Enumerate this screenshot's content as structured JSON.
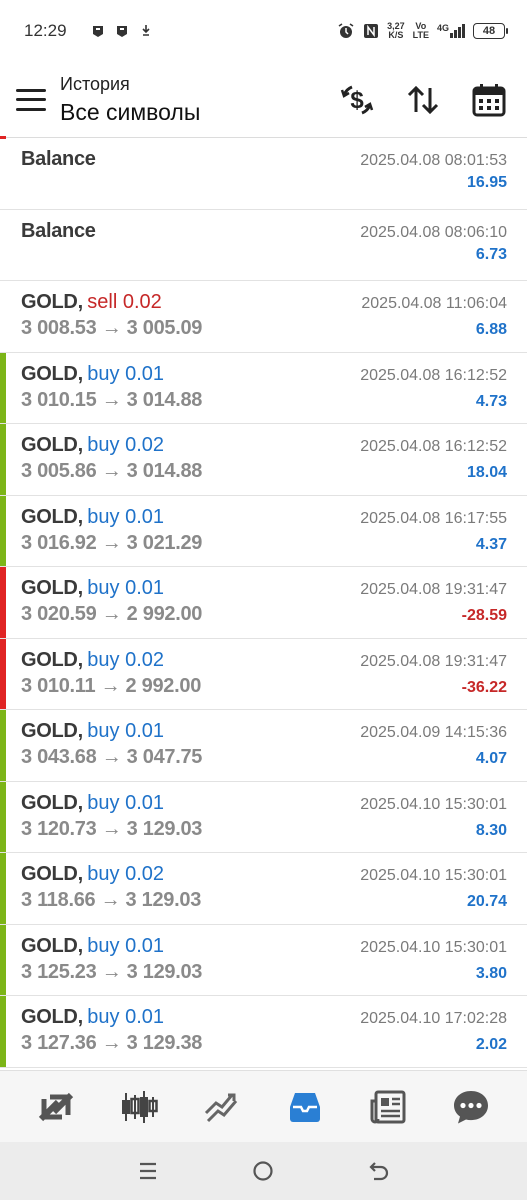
{
  "status_bar": {
    "time": "12:29",
    "speed_value": "3,27",
    "speed_unit": "K/S",
    "volte_top": "Vo",
    "volte_bottom": "LTE",
    "network": "4G",
    "battery": "48"
  },
  "header": {
    "subtitle": "История",
    "title": "Все символы"
  },
  "colors": {
    "buy": "#1f72c9",
    "sell": "#c62828",
    "bar_win": "#7cb518",
    "bar_loss": "#e02424"
  },
  "deals": [
    {
      "symbol": "Balance",
      "separator": "",
      "deal": "",
      "type": "none",
      "date": "2025.04.08 08:01:53",
      "prices": "",
      "profit": "16.95",
      "sign": "pos",
      "bar": "none"
    },
    {
      "symbol": "Balance",
      "separator": "",
      "deal": "",
      "type": "none",
      "date": "2025.04.08 08:06:10",
      "prices": "",
      "profit": "6.73",
      "sign": "pos",
      "bar": "none"
    },
    {
      "symbol": "GOLD",
      "separator": ",",
      "deal": "sell 0.02",
      "type": "sell",
      "date": "2025.04.08 11:06:04",
      "prices": "3 008.53 → 3 005.09",
      "profit": "6.88",
      "sign": "pos",
      "bar": "none"
    },
    {
      "symbol": "GOLD",
      "separator": ",",
      "deal": "buy 0.01",
      "type": "buy",
      "date": "2025.04.08 16:12:52",
      "prices": "3 010.15 → 3 014.88",
      "profit": "4.73",
      "sign": "pos",
      "bar": "win"
    },
    {
      "symbol": "GOLD",
      "separator": ",",
      "deal": "buy 0.02",
      "type": "buy",
      "date": "2025.04.08 16:12:52",
      "prices": "3 005.86 → 3 014.88",
      "profit": "18.04",
      "sign": "pos",
      "bar": "win"
    },
    {
      "symbol": "GOLD",
      "separator": ",",
      "deal": "buy 0.01",
      "type": "buy",
      "date": "2025.04.08 16:17:55",
      "prices": "3 016.92 → 3 021.29",
      "profit": "4.37",
      "sign": "pos",
      "bar": "win"
    },
    {
      "symbol": "GOLD",
      "separator": ",",
      "deal": "buy 0.01",
      "type": "buy",
      "date": "2025.04.08 19:31:47",
      "prices": "3 020.59 → 2 992.00",
      "profit": "-28.59",
      "sign": "neg",
      "bar": "loss"
    },
    {
      "symbol": "GOLD",
      "separator": ",",
      "deal": "buy 0.02",
      "type": "buy",
      "date": "2025.04.08 19:31:47",
      "prices": "3 010.11 → 2 992.00",
      "profit": "-36.22",
      "sign": "neg",
      "bar": "loss"
    },
    {
      "symbol": "GOLD",
      "separator": ",",
      "deal": "buy 0.01",
      "type": "buy",
      "date": "2025.04.09 14:15:36",
      "prices": "3 043.68 → 3 047.75",
      "profit": "4.07",
      "sign": "pos",
      "bar": "win"
    },
    {
      "symbol": "GOLD",
      "separator": ",",
      "deal": "buy 0.01",
      "type": "buy",
      "date": "2025.04.10 15:30:01",
      "prices": "3 120.73 → 3 129.03",
      "profit": "8.30",
      "sign": "pos",
      "bar": "win"
    },
    {
      "symbol": "GOLD",
      "separator": ",",
      "deal": "buy 0.02",
      "type": "buy",
      "date": "2025.04.10 15:30:01",
      "prices": "3 118.66 → 3 129.03",
      "profit": "20.74",
      "sign": "pos",
      "bar": "win"
    },
    {
      "symbol": "GOLD",
      "separator": ",",
      "deal": "buy 0.01",
      "type": "buy",
      "date": "2025.04.10 15:30:01",
      "prices": "3 125.23 → 3 129.03",
      "profit": "3.80",
      "sign": "pos",
      "bar": "win"
    },
    {
      "symbol": "GOLD",
      "separator": ",",
      "deal": "buy 0.01",
      "type": "buy",
      "date": "2025.04.10 17:02:28",
      "prices": "3 127.36 → 3 129.38",
      "profit": "2.02",
      "sign": "pos",
      "bar": "win"
    }
  ],
  "bottom_nav": [
    {
      "icon": "quotes-icon",
      "active": false
    },
    {
      "icon": "chart-icon",
      "active": false
    },
    {
      "icon": "trade-icon",
      "active": false
    },
    {
      "icon": "history-icon",
      "active": true
    },
    {
      "icon": "news-icon",
      "active": false
    },
    {
      "icon": "chat-icon",
      "active": false
    }
  ],
  "system_nav": [
    "menu-icon",
    "home-icon",
    "back-icon"
  ]
}
